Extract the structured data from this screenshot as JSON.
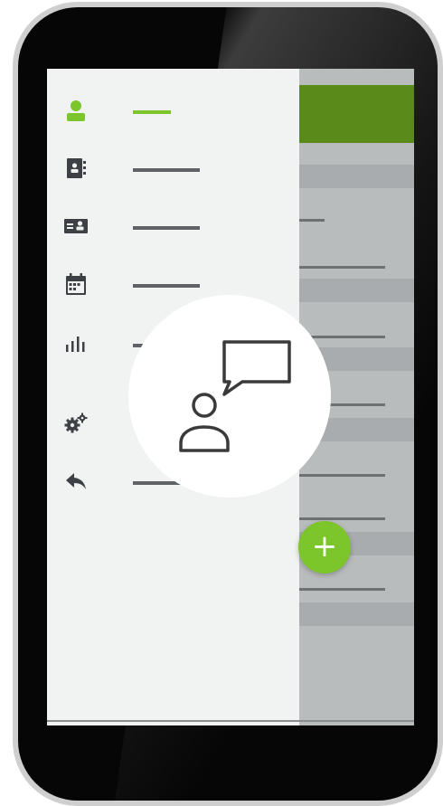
{
  "app": {
    "accent_color": "#7cc52a",
    "header_color": "#5a8a1a"
  },
  "drawer": {
    "items": [
      {
        "icon": "person-icon",
        "active": true
      },
      {
        "icon": "address-book-icon",
        "active": false
      },
      {
        "icon": "contact-card-icon",
        "active": false
      },
      {
        "icon": "calendar-icon",
        "active": false
      },
      {
        "icon": "bar-chart-icon",
        "active": false
      },
      {
        "icon": "settings-gears-icon",
        "active": false
      },
      {
        "icon": "back-arrow-icon",
        "active": false
      }
    ]
  },
  "fab": {
    "label": "+",
    "icon": "plus-icon"
  },
  "overlay": {
    "icon": "user-chat-icon"
  }
}
